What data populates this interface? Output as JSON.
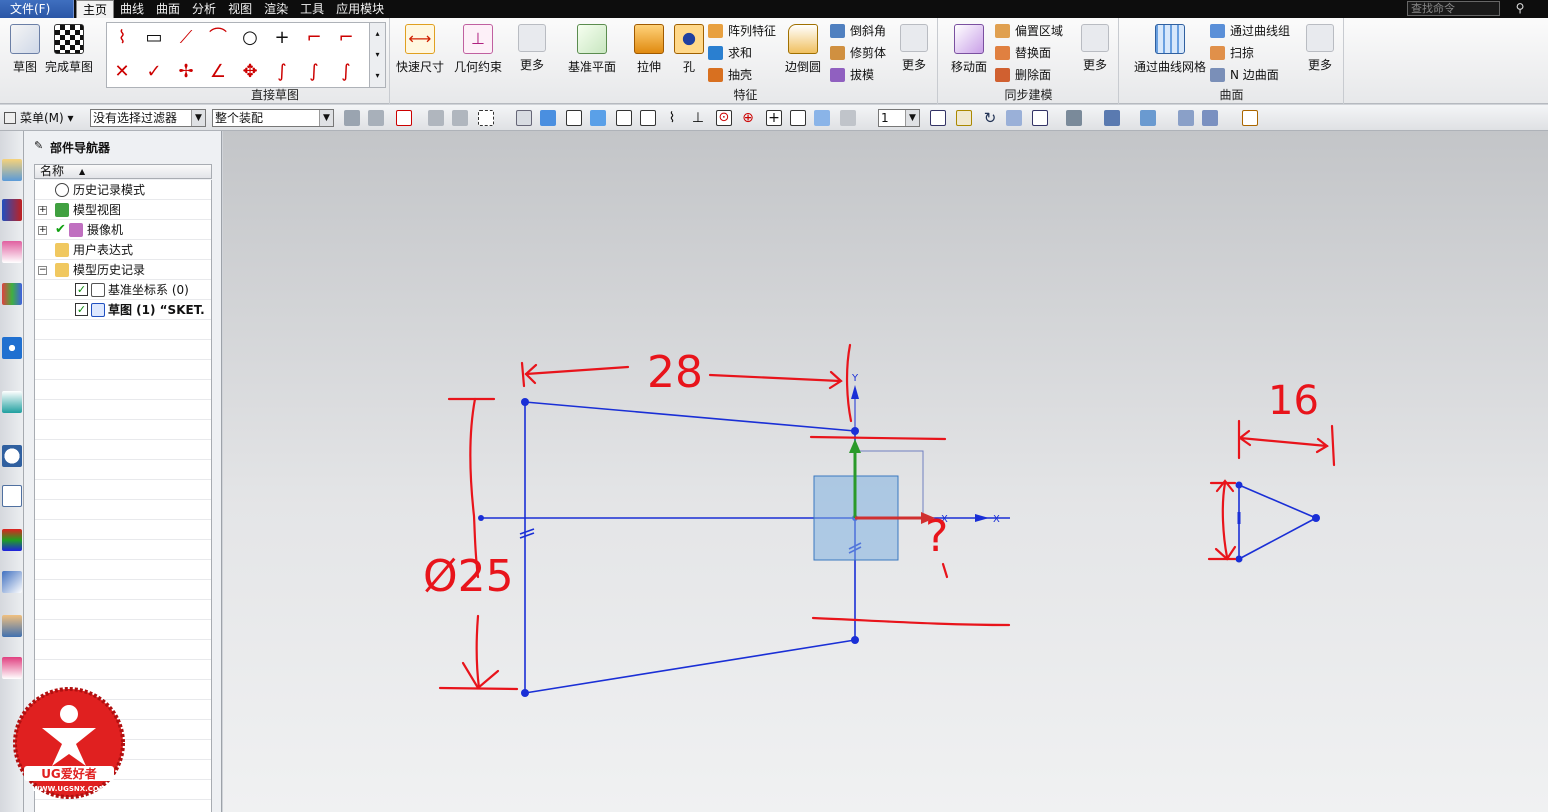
{
  "menubar": {
    "file_menu": "文件(F)",
    "tabs": [
      "主页",
      "曲线",
      "曲面",
      "分析",
      "视图",
      "渲染",
      "工具",
      "应用模块"
    ],
    "search_placeholder": "查找命令"
  },
  "ribbon": {
    "sketch": "草图",
    "finish_sketch": "完成草图",
    "direct_sketch_group": "直接草图",
    "quick_dimension": "快速尺寸",
    "geometric_constraints": "几何约束",
    "more": "更多",
    "datum_plane": "基准平面",
    "extrude": "拉伸",
    "hole": "孔",
    "pattern_feature": "阵列特征",
    "unite": "求和",
    "shell": "抽壳",
    "edge_blend": "边倒圆",
    "chamfer": "倒斜角",
    "trim_body": "修剪体",
    "draft": "拔模",
    "feature_group": "特征",
    "move_face": "移动面",
    "offset_region": "偏置区域",
    "replace_face": "替换面",
    "delete_face": "删除面",
    "sync_group": "同步建模",
    "through_curve_mesh": "通过曲线网格",
    "through_curves": "通过曲线组",
    "swept": "扫掠",
    "n_sided_surface": "N 边曲面",
    "surface_group": "曲面"
  },
  "toolbar": {
    "menu": "菜单(M)",
    "filter": "没有选择过滤器",
    "scope": "整个装配",
    "layer": "1"
  },
  "navigator": {
    "title": "部件导航器",
    "column": "名称",
    "items": [
      {
        "label": "历史记录模式"
      },
      {
        "label": "模型视图"
      },
      {
        "label": "摄像机"
      },
      {
        "label": "用户表达式"
      },
      {
        "label": "模型历史记录"
      },
      {
        "label": "基准坐标系 (0)"
      },
      {
        "label": "草图 (1) “SKET."
      }
    ]
  },
  "annotations": {
    "dim_28": "28",
    "dim_16": "16",
    "dim_25": "Ø25",
    "dim_unknown": "?"
  },
  "watermark": {
    "brand": "UG爱好者",
    "url": "WWW.UGSNX.COM"
  },
  "colors": {
    "sketch_line": "#1a2fd6",
    "annotation": "#e8141b",
    "canvas_top": "#c3c5c8",
    "canvas_bottom": "#f0f1f2"
  }
}
